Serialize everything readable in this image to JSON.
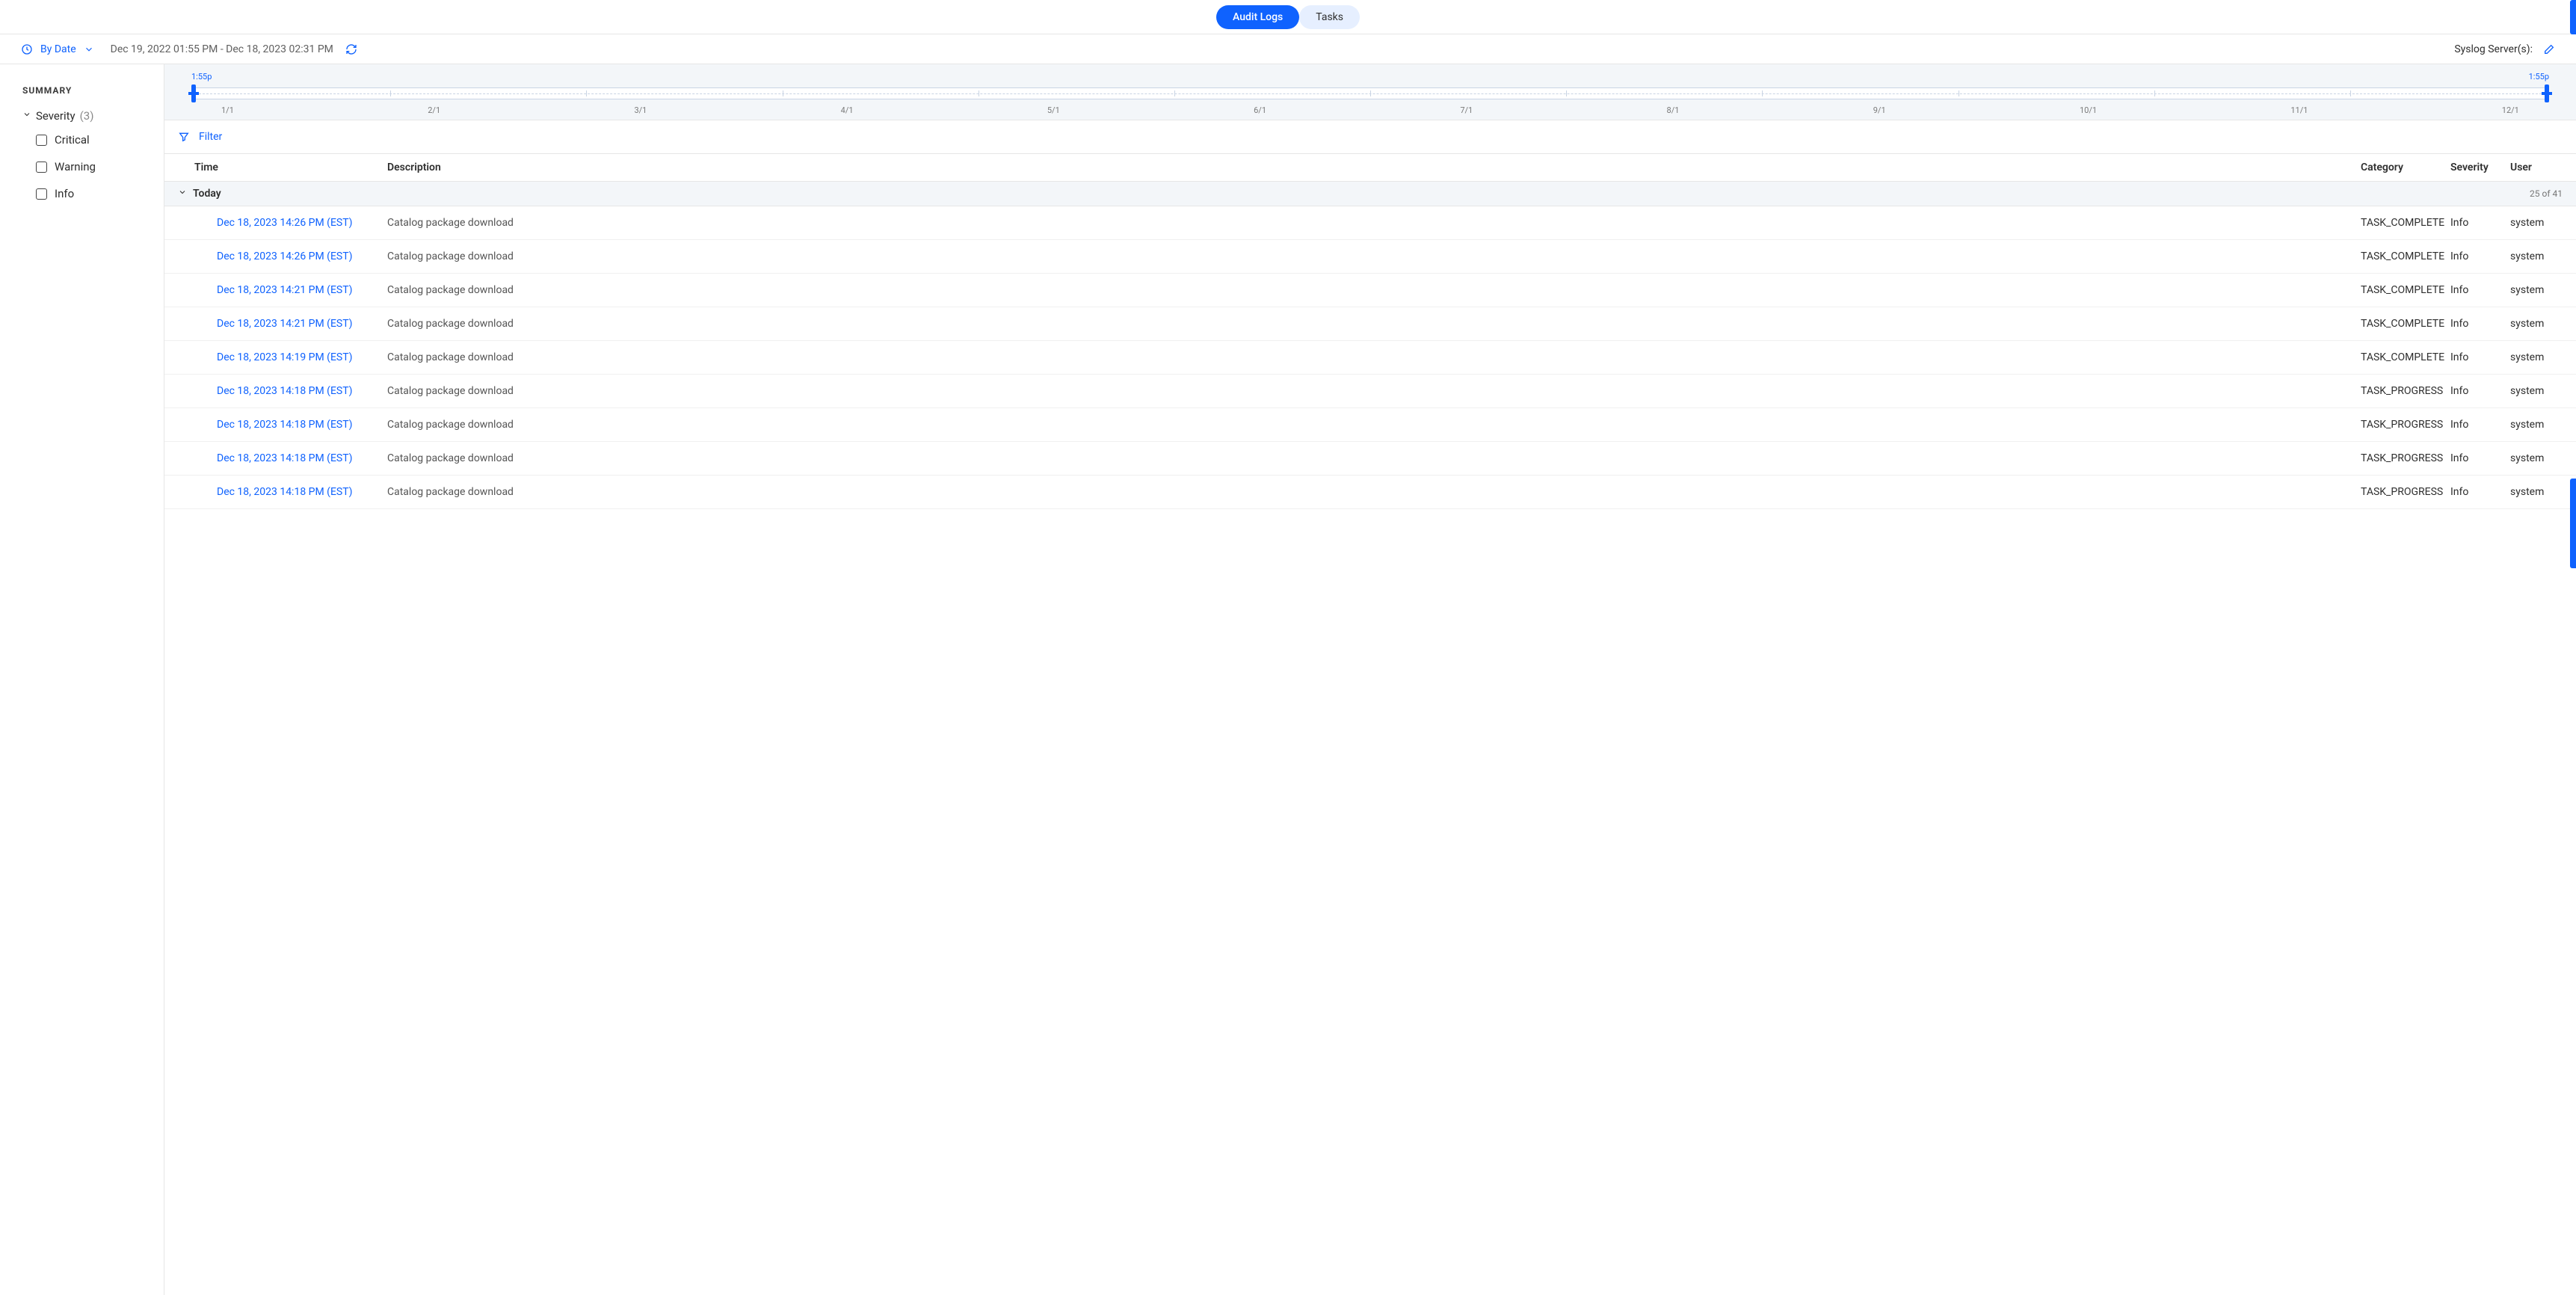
{
  "tabs": {
    "audit_logs": "Audit Logs",
    "tasks": "Tasks"
  },
  "toolbar": {
    "by_date_label": "By Date",
    "date_range": "Dec 19, 2022 01:55 PM - Dec 18, 2023 02:31 PM",
    "syslog_label": "Syslog Server(s):"
  },
  "sidebar": {
    "summary": "SUMMARY",
    "severity_label": "Severity",
    "severity_count": "(3)",
    "severities": [
      {
        "label": "Critical"
      },
      {
        "label": "Warning"
      },
      {
        "label": "Info"
      }
    ]
  },
  "timeline": {
    "start_label": "1:55p",
    "end_label": "1:55p",
    "months": [
      "1/1",
      "2/1",
      "3/1",
      "4/1",
      "5/1",
      "6/1",
      "7/1",
      "8/1",
      "9/1",
      "10/1",
      "11/1",
      "12/1"
    ]
  },
  "filter_label": "Filter",
  "columns": {
    "time": "Time",
    "description": "Description",
    "category": "Category",
    "severity": "Severity",
    "user": "User"
  },
  "group": {
    "label": "Today",
    "count": "25 of 41"
  },
  "rows": [
    {
      "time": "Dec 18, 2023 14:26 PM (EST)",
      "desc": "Catalog package download",
      "cat": "TASK_COMPLETE",
      "sev": "Info",
      "user": "system"
    },
    {
      "time": "Dec 18, 2023 14:26 PM (EST)",
      "desc": "Catalog package download",
      "cat": "TASK_COMPLETE",
      "sev": "Info",
      "user": "system"
    },
    {
      "time": "Dec 18, 2023 14:21 PM (EST)",
      "desc": "Catalog package download",
      "cat": "TASK_COMPLETE",
      "sev": "Info",
      "user": "system"
    },
    {
      "time": "Dec 18, 2023 14:21 PM (EST)",
      "desc": "Catalog package download",
      "cat": "TASK_COMPLETE",
      "sev": "Info",
      "user": "system"
    },
    {
      "time": "Dec 18, 2023 14:19 PM (EST)",
      "desc": "Catalog package download",
      "cat": "TASK_COMPLETE",
      "sev": "Info",
      "user": "system"
    },
    {
      "time": "Dec 18, 2023 14:18 PM (EST)",
      "desc": "Catalog package download",
      "cat": "TASK_PROGRESS",
      "sev": "Info",
      "user": "system"
    },
    {
      "time": "Dec 18, 2023 14:18 PM (EST)",
      "desc": "Catalog package download",
      "cat": "TASK_PROGRESS",
      "sev": "Info",
      "user": "system"
    },
    {
      "time": "Dec 18, 2023 14:18 PM (EST)",
      "desc": "Catalog package download",
      "cat": "TASK_PROGRESS",
      "sev": "Info",
      "user": "system"
    },
    {
      "time": "Dec 18, 2023 14:18 PM (EST)",
      "desc": "Catalog package download",
      "cat": "TASK_PROGRESS",
      "sev": "Info",
      "user": "system"
    }
  ]
}
